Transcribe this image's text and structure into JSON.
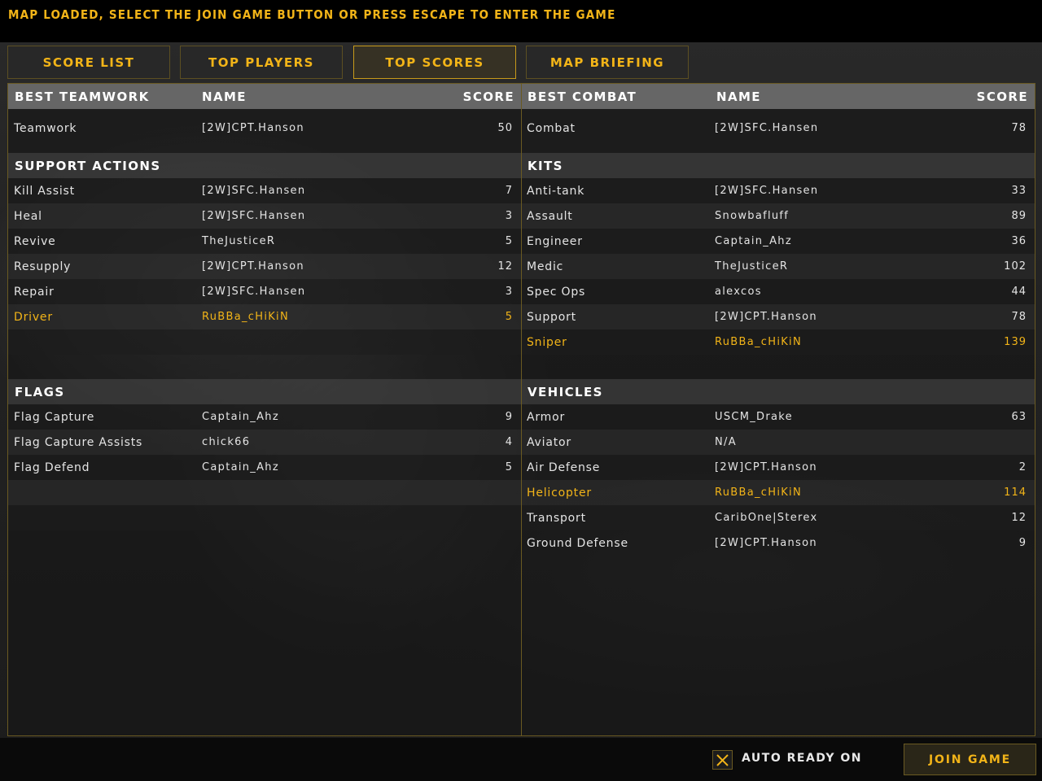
{
  "status_message": "MAP LOADED, SELECT THE JOIN GAME BUTTON OR PRESS ESCAPE TO ENTER THE GAME",
  "tabs": [
    {
      "label": "SCORE LIST",
      "active": false
    },
    {
      "label": "TOP PLAYERS",
      "active": false
    },
    {
      "label": "TOP SCORES",
      "active": true
    },
    {
      "label": "MAP BRIEFING",
      "active": false
    }
  ],
  "left": {
    "header": {
      "category": "BEST TEAMWORK",
      "name": "NAME",
      "score": "SCORE"
    },
    "teamwork": {
      "category": "Teamwork",
      "name": "[2W]CPT.Hanson",
      "score": "50"
    },
    "support_title": "SUPPORT ACTIONS",
    "support": [
      {
        "category": "Kill Assist",
        "name": "[2W]SFC.Hansen",
        "score": "7"
      },
      {
        "category": "Heal",
        "name": "[2W]SFC.Hansen",
        "score": "3"
      },
      {
        "category": "Revive",
        "name": "TheJusticeR",
        "score": "5"
      },
      {
        "category": "Resupply",
        "name": "[2W]CPT.Hanson",
        "score": "12"
      },
      {
        "category": "Repair",
        "name": "[2W]SFC.Hansen",
        "score": "3"
      },
      {
        "category": "Driver",
        "name": "RuBBa_cHiKiN",
        "score": "5"
      }
    ],
    "flags_title": "FLAGS",
    "flags": [
      {
        "category": "Flag Capture",
        "name": "Captain_Ahz",
        "score": "9"
      },
      {
        "category": "Flag Capture Assists",
        "name": "chick66",
        "score": "4"
      },
      {
        "category": "Flag Defend",
        "name": "Captain_Ahz",
        "score": "5"
      }
    ]
  },
  "right": {
    "header": {
      "category": "BEST COMBAT",
      "name": "NAME",
      "score": "SCORE"
    },
    "combat": {
      "category": "Combat",
      "name": "[2W]SFC.Hansen",
      "score": "78"
    },
    "kits_title": "KITS",
    "kits": [
      {
        "category": "Anti-tank",
        "name": "[2W]SFC.Hansen",
        "score": "33"
      },
      {
        "category": "Assault",
        "name": "Snowbafluff",
        "score": "89"
      },
      {
        "category": "Engineer",
        "name": "Captain_Ahz",
        "score": "36"
      },
      {
        "category": "Medic",
        "name": "TheJusticeR",
        "score": "102"
      },
      {
        "category": "Spec Ops",
        "name": "alexcos",
        "score": "44"
      },
      {
        "category": "Support",
        "name": "[2W]CPT.Hanson",
        "score": "78"
      },
      {
        "category": "Sniper",
        "name": "RuBBa_cHiKiN",
        "score": "139"
      }
    ],
    "vehicles_title": "VEHICLES",
    "vehicles": [
      {
        "category": "Armor",
        "name": "USCM_Drake",
        "score": "63"
      },
      {
        "category": "Aviator",
        "name": "N/A",
        "score": ""
      },
      {
        "category": "Air Defense",
        "name": "[2W]CPT.Hanson",
        "score": "2"
      },
      {
        "category": "Helicopter",
        "name": "RuBBa_cHiKiN",
        "score": "114"
      },
      {
        "category": "Transport",
        "name": "CaribOne|Sterex",
        "score": "12"
      },
      {
        "category": "Ground Defense",
        "name": "[2W]CPT.Hanson",
        "score": "9"
      }
    ]
  },
  "footer": {
    "auto_ready_label": "AUTO READY ON",
    "auto_ready_checked": true,
    "join_label": "JOIN GAME"
  },
  "colors": {
    "accent": "#f2b418",
    "border": "#6a5a22",
    "header_bg": "#737373"
  }
}
